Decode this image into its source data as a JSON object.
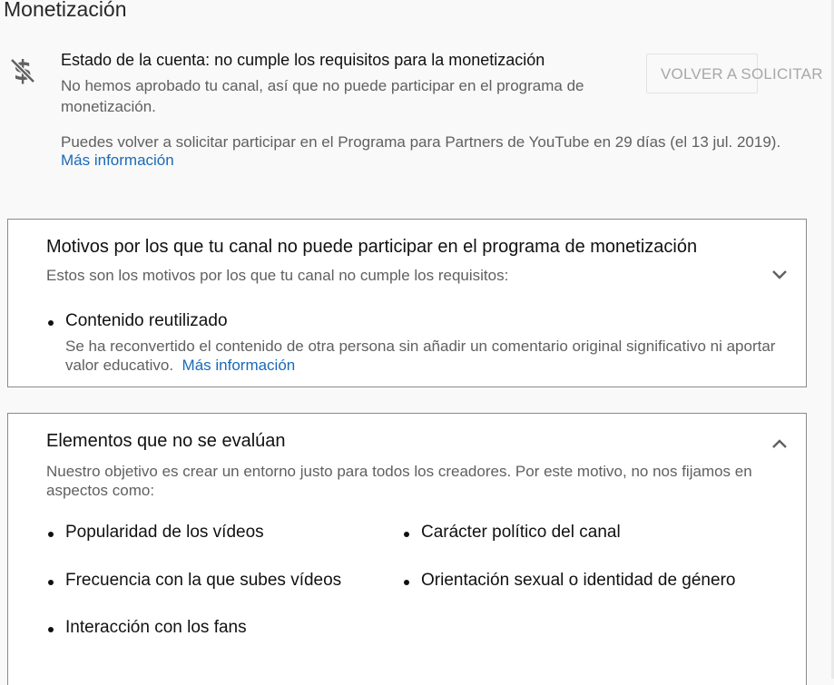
{
  "page": {
    "title": "Monetización"
  },
  "status": {
    "icon": "no-monetization-dollar-icon",
    "title": "Estado de la cuenta: no cumple los requisitos para la monetización",
    "description": "No hemos aprobado tu canal, así que no puede participar en el programa de monetización.",
    "reapply_info": "Puedes volver a solicitar participar en el Programa para Partners de YouTube en 29 días (el 13 jul. 2019).",
    "more_info_link": "Más información",
    "reapply_button": "VOLVER A SOLICITAR"
  },
  "reasons_card": {
    "title": "Motivos por los que tu canal no puede participar en el programa de monetización",
    "subtitle": "Estos son los motivos por los que tu canal no cumple los requisitos:",
    "chevron_icon": "chevron-down-icon",
    "items": [
      {
        "label": "Contenido reutilizado",
        "description": "Se ha reconvertido el contenido de otra persona sin añadir un comentario original significativo ni aportar valor educativo.",
        "link": "Más información"
      }
    ]
  },
  "not_evaluated_card": {
    "title": "Elementos que no se evalúan",
    "subtitle": "Nuestro objetivo es crear un entorno justo para todos los creadores. Por este motivo, no nos fijamos en aspectos como:",
    "chevron_icon": "chevron-up-icon",
    "items": [
      "Popularidad de los vídeos",
      "Carácter político del canal",
      "Frecuencia con la que subes vídeos",
      "Orientación sexual o identidad de género",
      "Interacción con los fans"
    ]
  },
  "colors": {
    "link": "#1a6ab8",
    "secondary_text": "#606060",
    "border": "#8a8a8a",
    "disabled_button_text": "#a8a8a8"
  }
}
